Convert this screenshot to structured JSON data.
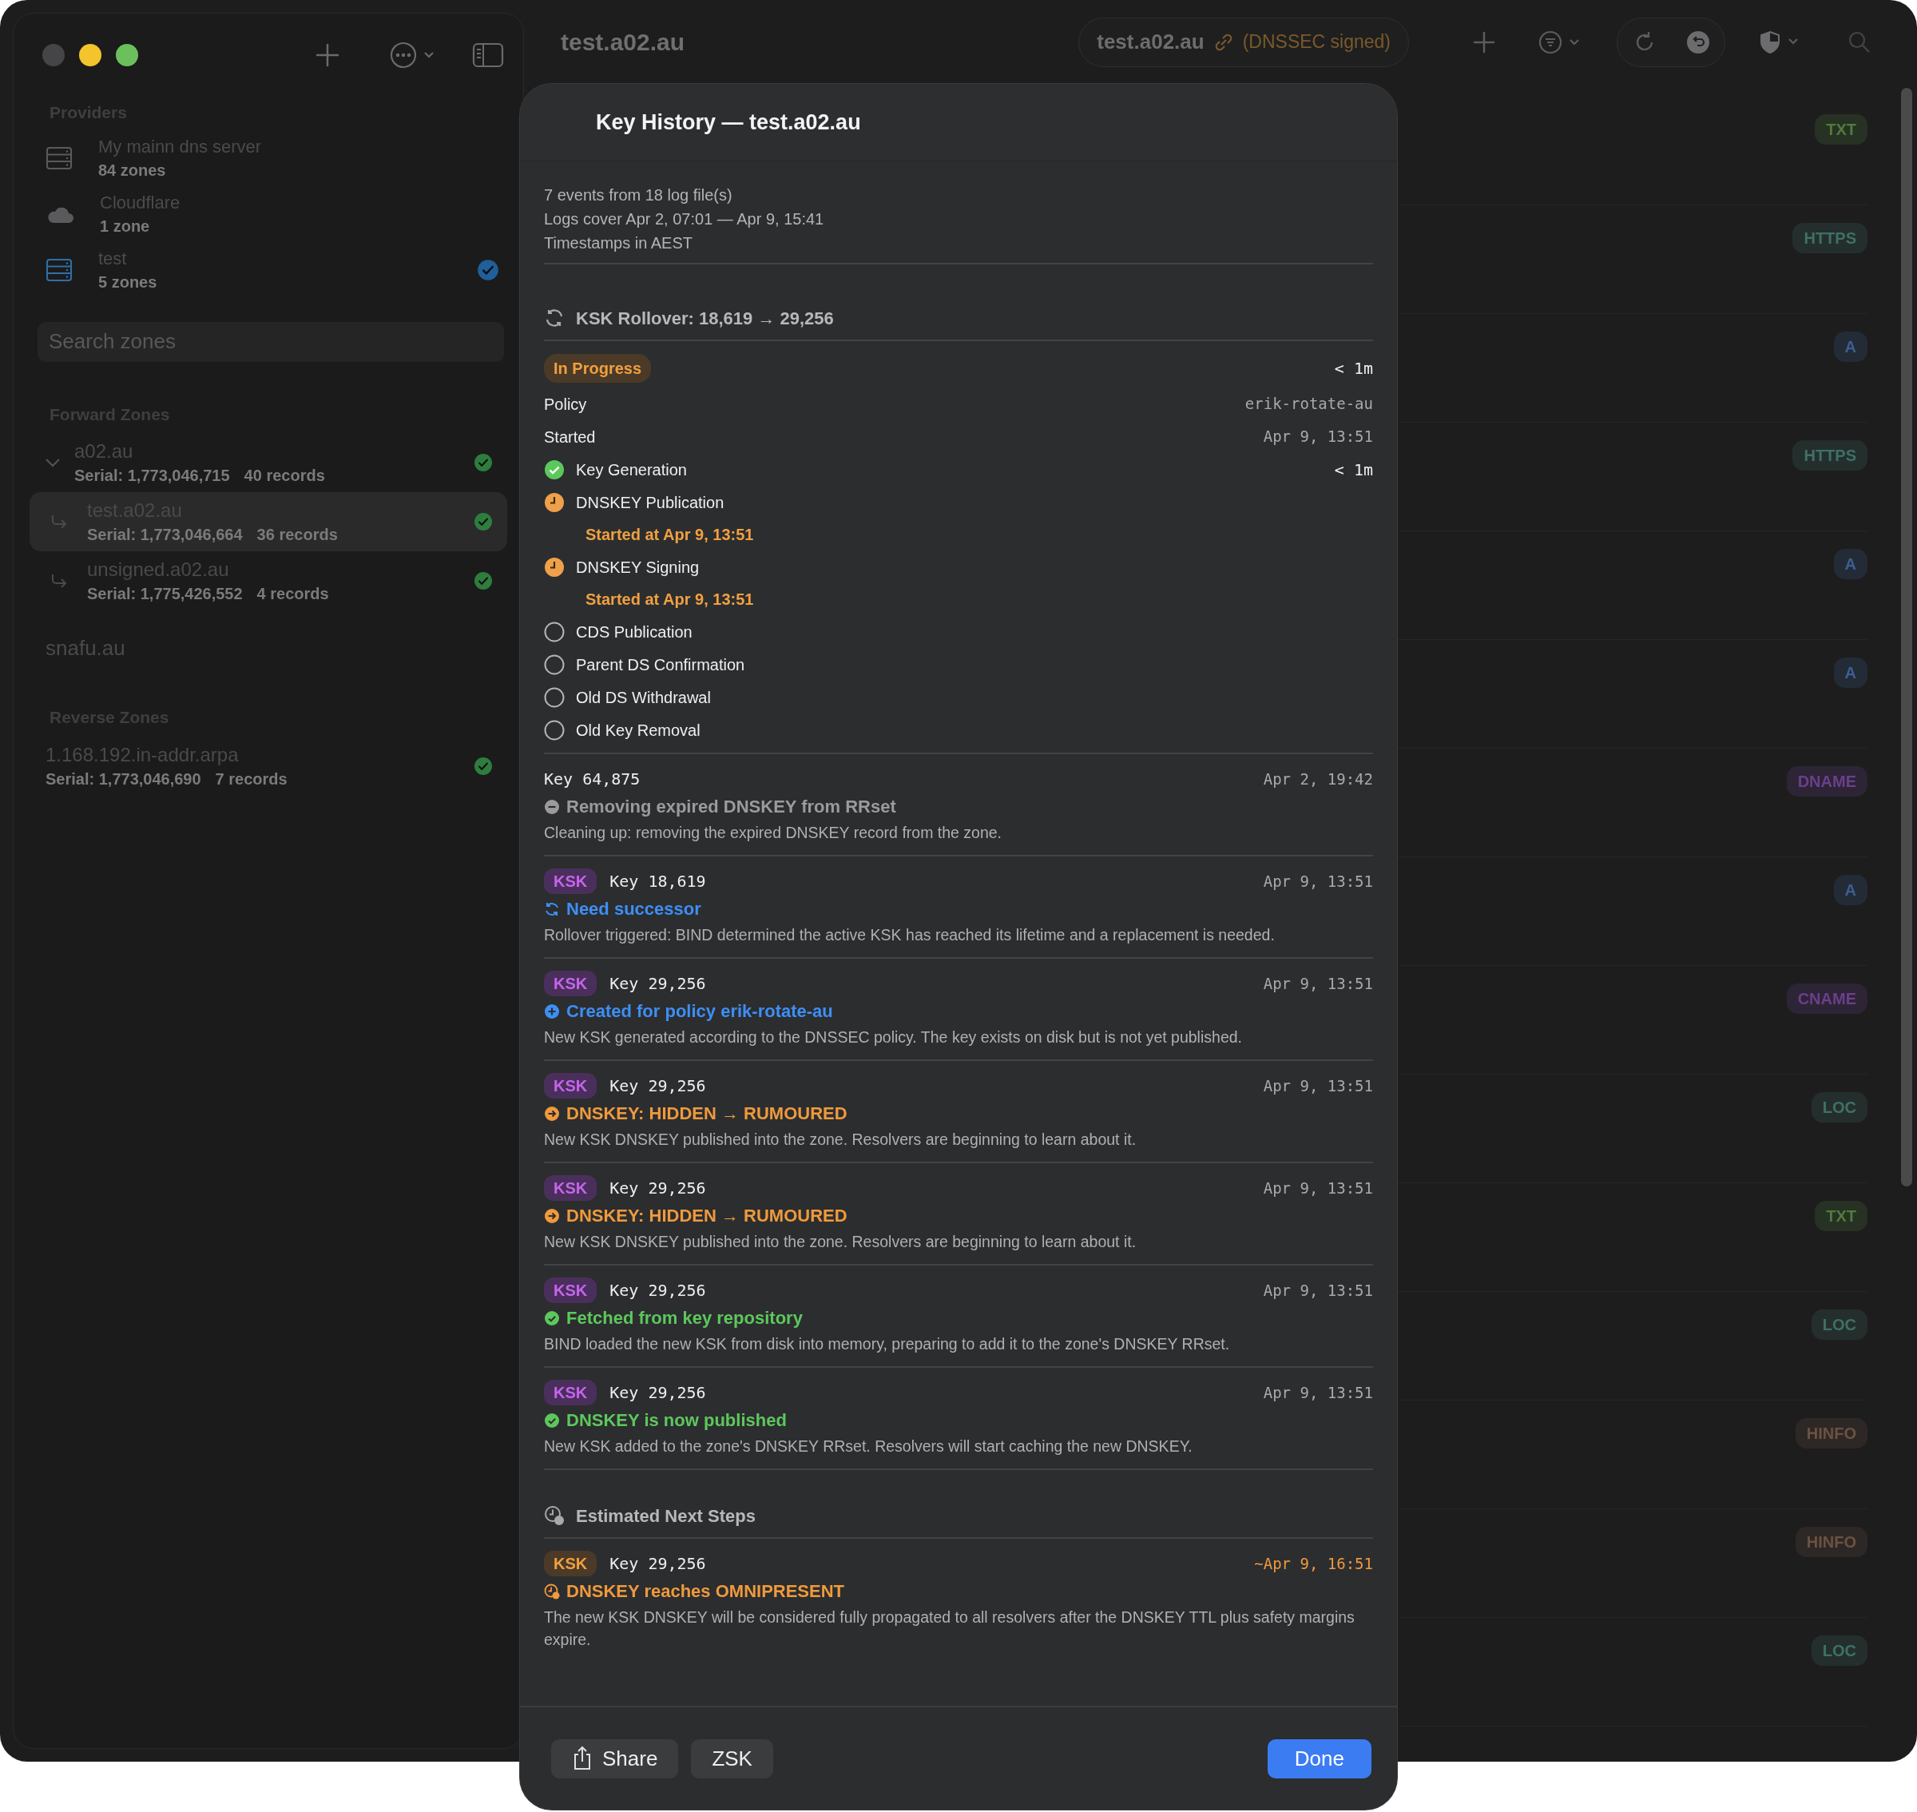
{
  "window": {
    "title": "test.a02.au"
  },
  "toolbar": {
    "zone_name": "test.a02.au",
    "zone_status": "(DNSSEC signed)"
  },
  "sidebar": {
    "providers_heading": "Providers",
    "providers": [
      {
        "name": "My mainn dns server",
        "count": "84 zones",
        "kind": "server",
        "checked": false
      },
      {
        "name": "Cloudflare",
        "count": "1 zone",
        "kind": "cloud",
        "checked": false
      },
      {
        "name": "test",
        "count": "5 zones",
        "kind": "server",
        "checked": true
      }
    ],
    "search": {
      "placeholder": "Search zones"
    },
    "forward_heading": "Forward Zones",
    "forward_zones": [
      {
        "name": "a02.au",
        "serial": "Serial: 1,773,046,715",
        "records": "40 records",
        "checked": true,
        "selected": false,
        "expanded": true,
        "children": [
          {
            "name": "test.a02.au",
            "serial": "Serial: 1,773,046,664",
            "records": "36 records",
            "checked": true,
            "selected": true
          },
          {
            "name": "unsigned.a02.au",
            "serial": "Serial: 1,775,426,552",
            "records": "4 records",
            "checked": true,
            "selected": false
          }
        ]
      },
      {
        "name": "snafu.au",
        "checked": false,
        "selected": false
      }
    ],
    "reverse_heading": "Reverse Zones",
    "reverse_zones": [
      {
        "name": "1.168.192.in-addr.arpa",
        "serial": "Serial: 1,773,046,690",
        "records": "7 records",
        "checked": true,
        "selected": false
      }
    ]
  },
  "records": [
    {
      "type": "TXT",
      "color": "#4f7d3b"
    },
    {
      "type": "HTTPS",
      "color": "#3f7066"
    },
    {
      "type": "A",
      "color": "#3d5f92"
    },
    {
      "type": "HTTPS",
      "color": "#3f7066"
    },
    {
      "type": "A",
      "color": "#3d5f92"
    },
    {
      "type": "A",
      "color": "#3d5f92"
    },
    {
      "type": "DNAME",
      "color": "#6b3f8c"
    },
    {
      "type": "A",
      "color": "#3d5f92"
    },
    {
      "type": "CNAME",
      "color": "#6b3f8c"
    },
    {
      "type": "LOC",
      "color": "#3f7066"
    },
    {
      "type": "TXT",
      "color": "#4f7d3b"
    },
    {
      "type": "LOC",
      "color": "#3f7066"
    },
    {
      "type": "HINFO",
      "color": "#6b5242"
    },
    {
      "type": "HINFO",
      "color": "#6b5242"
    },
    {
      "type": "LOC",
      "color": "#3f7066"
    }
  ],
  "sheet": {
    "title": "Key History — test.a02.au",
    "summary": [
      "7 events from 18 log file(s)",
      "Logs cover Apr 2, 07:01 — Apr 9, 15:41",
      "Timestamps in AEST"
    ],
    "rollover": {
      "title": "KSK Rollover: 18,619 → 29,256",
      "status": "In Progress",
      "elapsed": "< 1m",
      "fields": [
        {
          "label": "Policy",
          "value": "erik-rotate-au"
        },
        {
          "label": "Started",
          "value": "Apr 9, 13:51"
        }
      ],
      "steps": [
        {
          "label": "Key Generation",
          "kind": "done",
          "duration": "< 1m"
        },
        {
          "label": "DNSKEY Publication",
          "kind": "active",
          "note": "Started at Apr 9, 13:51"
        },
        {
          "label": "DNSKEY Signing",
          "kind": "active",
          "note": "Started at Apr 9, 13:51"
        },
        {
          "label": "CDS Publication",
          "kind": "pending"
        },
        {
          "label": "Parent DS Confirmation",
          "kind": "pending"
        },
        {
          "label": "Old DS Withdrawal",
          "kind": "pending"
        },
        {
          "label": "Old Key Removal",
          "kind": "pending"
        }
      ]
    },
    "events": [
      {
        "kind": "removed",
        "key": "Key 64,875",
        "time": "Apr 2, 19:42",
        "title": "Removing expired DNSKEY from RRset",
        "description": "Cleaning up: removing the expired DNSKEY record from the zone."
      },
      {
        "kind": "successor",
        "tag": "KSK",
        "key": "Key 18,619",
        "time": "Apr 9, 13:51",
        "title": "Need successor",
        "description": "Rollover triggered: BIND determined the active KSK has reached its lifetime and a replacement is needed."
      },
      {
        "kind": "created",
        "tag": "KSK",
        "key": "Key 29,256",
        "time": "Apr 9, 13:51",
        "title": "Created for policy erik-rotate-au",
        "description": "New KSK generated according to the DNSSEC policy. The key exists on disk but is not yet published."
      },
      {
        "kind": "transition",
        "tag": "KSK",
        "key": "Key 29,256",
        "time": "Apr 9, 13:51",
        "title": "DNSKEY: HIDDEN → RUMOURED",
        "description": "New KSK DNSKEY published into the zone. Resolvers are beginning to learn about it."
      },
      {
        "kind": "transition",
        "tag": "KSK",
        "key": "Key 29,256",
        "time": "Apr 9, 13:51",
        "title": "DNSKEY: HIDDEN → RUMOURED",
        "description": "New KSK DNSKEY published into the zone. Resolvers are beginning to learn about it."
      },
      {
        "kind": "done",
        "tag": "KSK",
        "key": "Key 29,256",
        "time": "Apr 9, 13:51",
        "title": "Fetched from key repository",
        "description": "BIND loaded the new KSK from disk into memory, preparing to add it to the zone's DNSKEY RRset."
      },
      {
        "kind": "done",
        "tag": "KSK",
        "key": "Key 29,256",
        "time": "Apr 9, 13:51",
        "title": "DNSKEY is now published",
        "description": "New KSK added to the zone's DNSKEY RRset. Resolvers will start caching the new DNSKEY."
      }
    ],
    "next_steps": {
      "heading": "Estimated Next Steps",
      "items": [
        {
          "kind": "estimate",
          "tag": "KSK",
          "key": "Key 29,256",
          "time": "~Apr 9, 16:51",
          "title": "DNSKEY reaches OMNIPRESENT",
          "description": "The new KSK DNSKEY will be considered fully propagated to all resolvers after the DNSKEY TTL plus safety margins expire."
        }
      ]
    },
    "buttons": [
      {
        "label": "Share",
        "kind": "share"
      },
      {
        "label": "ZSK",
        "kind": "plain"
      },
      {
        "label": "Done",
        "kind": "primary"
      }
    ]
  }
}
